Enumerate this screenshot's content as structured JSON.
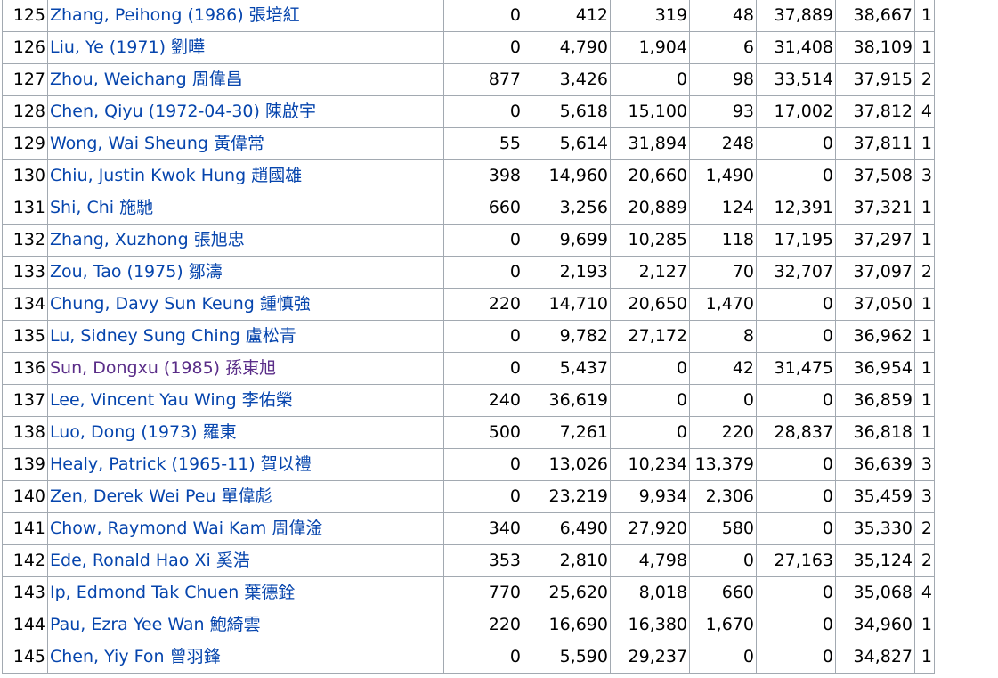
{
  "colors": {
    "link": "#0645ad",
    "visited_link": "#5a2d88",
    "border": "#a2a9b1"
  },
  "rows": [
    {
      "rank": "125",
      "name": "Zhang, Peihong (1986) 張培紅",
      "visited": false,
      "c1": "0",
      "c2": "412",
      "c3": "319",
      "c4": "48",
      "c5": "37,889",
      "c6": "38,667",
      "c7": "1"
    },
    {
      "rank": "126",
      "name": "Liu, Ye (1971) 劉曄",
      "visited": false,
      "c1": "0",
      "c2": "4,790",
      "c3": "1,904",
      "c4": "6",
      "c5": "31,408",
      "c6": "38,109",
      "c7": "1"
    },
    {
      "rank": "127",
      "name": "Zhou, Weichang 周偉昌",
      "visited": false,
      "c1": "877",
      "c2": "3,426",
      "c3": "0",
      "c4": "98",
      "c5": "33,514",
      "c6": "37,915",
      "c7": "2"
    },
    {
      "rank": "128",
      "name": "Chen, Qiyu (1972-04-30) 陳啟宇",
      "visited": false,
      "c1": "0",
      "c2": "5,618",
      "c3": "15,100",
      "c4": "93",
      "c5": "17,002",
      "c6": "37,812",
      "c7": "4"
    },
    {
      "rank": "129",
      "name": "Wong, Wai Sheung 黃偉常",
      "visited": false,
      "c1": "55",
      "c2": "5,614",
      "c3": "31,894",
      "c4": "248",
      "c5": "0",
      "c6": "37,811",
      "c7": "1"
    },
    {
      "rank": "130",
      "name": "Chiu, Justin Kwok Hung 趙國雄",
      "visited": false,
      "c1": "398",
      "c2": "14,960",
      "c3": "20,660",
      "c4": "1,490",
      "c5": "0",
      "c6": "37,508",
      "c7": "3"
    },
    {
      "rank": "131",
      "name": "Shi, Chi 施馳",
      "visited": false,
      "c1": "660",
      "c2": "3,256",
      "c3": "20,889",
      "c4": "124",
      "c5": "12,391",
      "c6": "37,321",
      "c7": "1"
    },
    {
      "rank": "132",
      "name": "Zhang, Xuzhong 張旭忠",
      "visited": false,
      "c1": "0",
      "c2": "9,699",
      "c3": "10,285",
      "c4": "118",
      "c5": "17,195",
      "c6": "37,297",
      "c7": "1"
    },
    {
      "rank": "133",
      "name": "Zou, Tao (1975) 鄒濤",
      "visited": false,
      "c1": "0",
      "c2": "2,193",
      "c3": "2,127",
      "c4": "70",
      "c5": "32,707",
      "c6": "37,097",
      "c7": "2"
    },
    {
      "rank": "134",
      "name": "Chung, Davy Sun Keung 鍾慎強",
      "visited": false,
      "c1": "220",
      "c2": "14,710",
      "c3": "20,650",
      "c4": "1,470",
      "c5": "0",
      "c6": "37,050",
      "c7": "1"
    },
    {
      "rank": "135",
      "name": "Lu, Sidney Sung Ching 盧松青",
      "visited": false,
      "c1": "0",
      "c2": "9,782",
      "c3": "27,172",
      "c4": "8",
      "c5": "0",
      "c6": "36,962",
      "c7": "1"
    },
    {
      "rank": "136",
      "name": "Sun, Dongxu (1985) 孫東旭",
      "visited": true,
      "c1": "0",
      "c2": "5,437",
      "c3": "0",
      "c4": "42",
      "c5": "31,475",
      "c6": "36,954",
      "c7": "1"
    },
    {
      "rank": "137",
      "name": "Lee, Vincent Yau Wing 李佑榮",
      "visited": false,
      "c1": "240",
      "c2": "36,619",
      "c3": "0",
      "c4": "0",
      "c5": "0",
      "c6": "36,859",
      "c7": "1"
    },
    {
      "rank": "138",
      "name": "Luo, Dong (1973) 羅東",
      "visited": false,
      "c1": "500",
      "c2": "7,261",
      "c3": "0",
      "c4": "220",
      "c5": "28,837",
      "c6": "36,818",
      "c7": "1"
    },
    {
      "rank": "139",
      "name": "Healy, Patrick (1965-11) 賀以禮",
      "visited": false,
      "c1": "0",
      "c2": "13,026",
      "c3": "10,234",
      "c4": "13,379",
      "c5": "0",
      "c6": "36,639",
      "c7": "3"
    },
    {
      "rank": "140",
      "name": "Zen, Derek Wei Peu 單偉彪",
      "visited": false,
      "c1": "0",
      "c2": "23,219",
      "c3": "9,934",
      "c4": "2,306",
      "c5": "0",
      "c6": "35,459",
      "c7": "3"
    },
    {
      "rank": "141",
      "name": "Chow, Raymond Wai Kam 周偉淦",
      "visited": false,
      "c1": "340",
      "c2": "6,490",
      "c3": "27,920",
      "c4": "580",
      "c5": "0",
      "c6": "35,330",
      "c7": "2"
    },
    {
      "rank": "142",
      "name": "Ede, Ronald Hao Xi 奚浩",
      "visited": false,
      "c1": "353",
      "c2": "2,810",
      "c3": "4,798",
      "c4": "0",
      "c5": "27,163",
      "c6": "35,124",
      "c7": "2"
    },
    {
      "rank": "143",
      "name": "Ip, Edmond Tak Chuen 葉德銓",
      "visited": false,
      "c1": "770",
      "c2": "25,620",
      "c3": "8,018",
      "c4": "660",
      "c5": "0",
      "c6": "35,068",
      "c7": "4"
    },
    {
      "rank": "144",
      "name": "Pau, Ezra Yee Wan 鮑綺雲",
      "visited": false,
      "c1": "220",
      "c2": "16,690",
      "c3": "16,380",
      "c4": "1,670",
      "c5": "0",
      "c6": "34,960",
      "c7": "1"
    },
    {
      "rank": "145",
      "name": "Chen, Yiy Fon 曾羽鋒",
      "visited": false,
      "c1": "0",
      "c2": "5,590",
      "c3": "29,237",
      "c4": "0",
      "c5": "0",
      "c6": "34,827",
      "c7": "1"
    }
  ]
}
